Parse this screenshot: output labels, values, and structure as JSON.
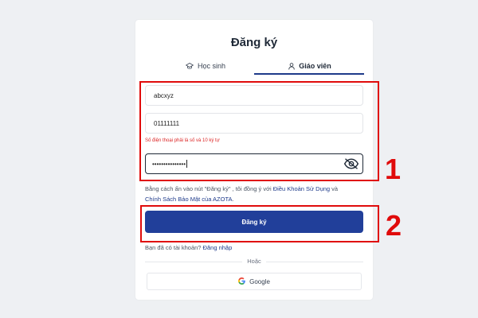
{
  "title": "Đăng ký",
  "tabs": {
    "student": {
      "label": "Học sinh",
      "icon": "graduation-cap-icon"
    },
    "teacher": {
      "label": "Giáo viên",
      "icon": "user-icon",
      "active": true
    }
  },
  "form": {
    "username": {
      "value": "abcxyz"
    },
    "phone": {
      "value": "01111111",
      "error": "Số điện thoại phải là số và 10 ký tự"
    },
    "password": {
      "value": "•••••••••••••••",
      "toggle_icon": "eye-slash-icon"
    }
  },
  "terms": {
    "prefix": "Bằng cách ấn vào nút \"Đăng ký\" , tôi đồng ý với ",
    "terms_link": "Điều Khoản Sử Dụng",
    "middle": " và",
    "privacy_link": "Chính Sách Bảo Mật của AZOTA",
    "suffix": "."
  },
  "register_button": "Đăng ký",
  "login": {
    "prefix": "Bạn đã có tài khoản? ",
    "link": "Đăng nhập"
  },
  "divider_text": "Hoặc",
  "google_button": {
    "label": "Google",
    "icon": "google-icon"
  },
  "annotations": {
    "marker1": "1",
    "marker2": "2"
  },
  "colors": {
    "primary": "#213f9a",
    "error": "#dc2626",
    "highlight": "#e00b0b"
  }
}
